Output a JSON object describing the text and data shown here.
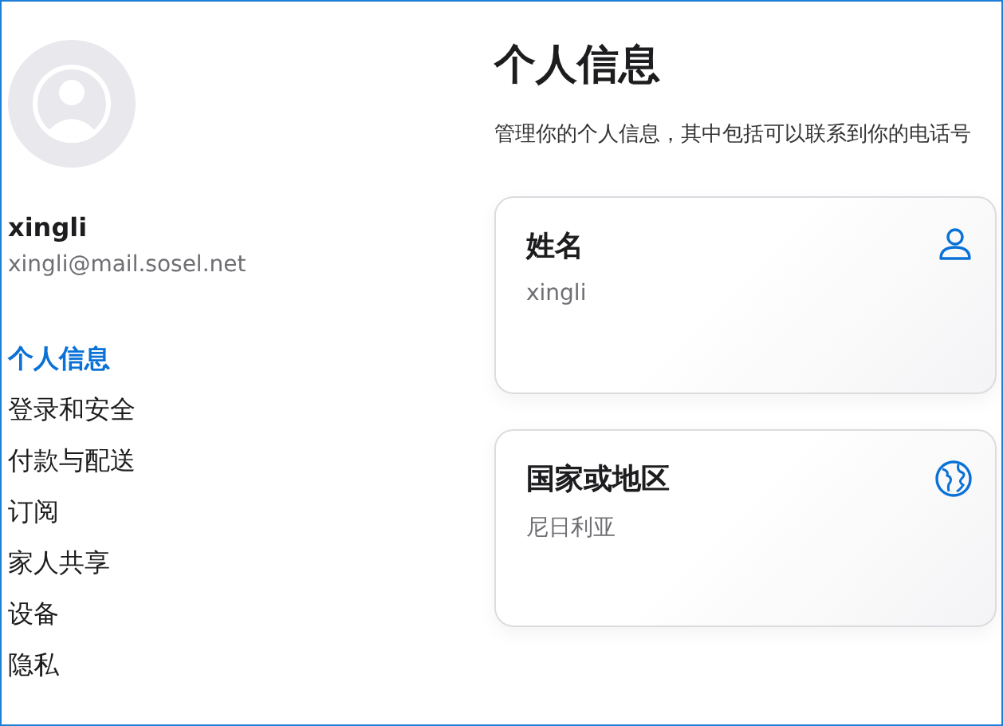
{
  "profile": {
    "name": "xingli",
    "email": "xingli@mail.sosel.net"
  },
  "sidebar": {
    "items": [
      {
        "label": "个人信息",
        "selected": true
      },
      {
        "label": "登录和安全",
        "selected": false
      },
      {
        "label": "付款与配送",
        "selected": false
      },
      {
        "label": "订阅",
        "selected": false
      },
      {
        "label": "家人共享",
        "selected": false
      },
      {
        "label": "设备",
        "selected": false
      },
      {
        "label": "隐私",
        "selected": false
      }
    ]
  },
  "main": {
    "title": "个人信息",
    "description": "管理你的个人信息，其中包括可以联系到你的电话号",
    "cards": [
      {
        "kind": "person",
        "title": "姓名",
        "value": "xingli"
      },
      {
        "kind": "globe",
        "title": "国家或地区",
        "value": "尼日利亚"
      }
    ]
  }
}
